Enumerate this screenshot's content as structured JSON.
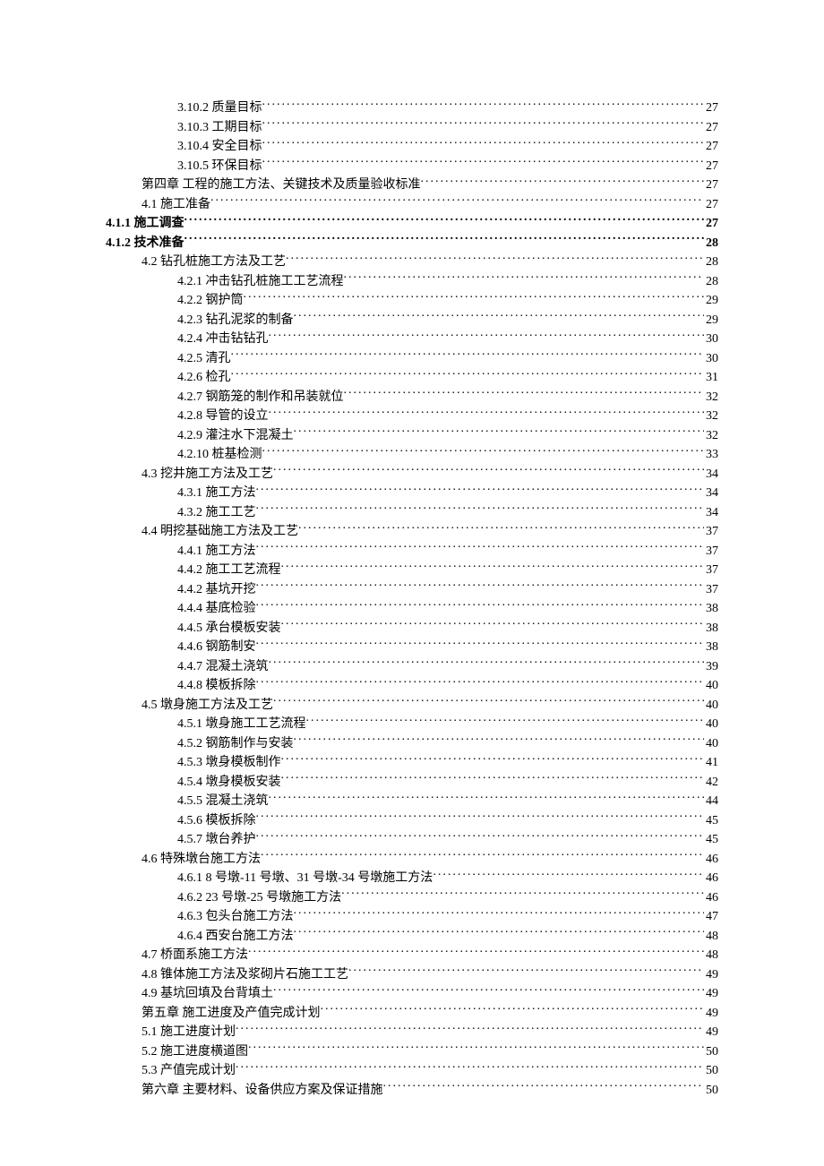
{
  "toc": [
    {
      "level": 2,
      "num": "3.10.2",
      "label": "质量目标",
      "page": "27",
      "bold": false
    },
    {
      "level": 2,
      "num": "3.10.3",
      "label": "工期目标",
      "page": "27",
      "bold": false
    },
    {
      "level": 2,
      "num": "3.10.4",
      "label": "安全目标",
      "page": "27",
      "bold": false
    },
    {
      "level": 2,
      "num": "3.10.5",
      "label": "环保目标",
      "page": "27",
      "bold": false
    },
    {
      "level": 1,
      "num": "第四章",
      "label": "  工程的施工方法、关键技术及质量验收标准",
      "page": "27",
      "bold": false
    },
    {
      "level": 1,
      "num": "4.1",
      "label": "施工准备",
      "page": "27",
      "bold": false
    },
    {
      "level": 0,
      "num": "4.1.1",
      "label": "施工调查",
      "page": "27",
      "bold": true
    },
    {
      "level": 0,
      "num": "4.1.2",
      "label": "技术准备",
      "page": "28",
      "bold": true
    },
    {
      "level": 1,
      "num": "4.2",
      "label": "钻孔桩施工方法及工艺",
      "page": "28",
      "bold": false
    },
    {
      "level": 2,
      "num": "4.2.1",
      "label": "冲击钻孔桩施工工艺流程",
      "page": "28",
      "bold": false
    },
    {
      "level": 2,
      "num": "4.2.2",
      "label": "钢护筒",
      "page": "29",
      "bold": false
    },
    {
      "level": 2,
      "num": "4.2.3",
      "label": "钻孔泥浆的制备",
      "page": "29",
      "bold": false
    },
    {
      "level": 2,
      "num": "4.2.4",
      "label": "冲击钻钻孔",
      "page": "30",
      "bold": false
    },
    {
      "level": 2,
      "num": "4.2.5",
      "label": "清孔",
      "page": "30",
      "bold": false
    },
    {
      "level": 2,
      "num": "4.2.6",
      "label": "检孔",
      "page": "31",
      "bold": false
    },
    {
      "level": 2,
      "num": "4.2.7",
      "label": "钢筋笼的制作和吊装就位",
      "page": "32",
      "bold": false
    },
    {
      "level": 2,
      "num": "4.2.8",
      "label": "导管的设立",
      "page": "32",
      "bold": false
    },
    {
      "level": 2,
      "num": "4.2.9",
      "label": "灌注水下混凝土",
      "page": "32",
      "bold": false
    },
    {
      "level": 2,
      "num": "4.2.10",
      "label": "桩基检测",
      "page": "33",
      "bold": false
    },
    {
      "level": 1,
      "num": "4.3",
      "label": "挖井施工方法及工艺",
      "page": "34",
      "bold": false
    },
    {
      "level": 2,
      "num": "4.3.1",
      "label": "施工方法",
      "page": "34",
      "bold": false
    },
    {
      "level": 2,
      "num": "4.3.2",
      "label": "施工工艺",
      "page": "34",
      "bold": false
    },
    {
      "level": 1,
      "num": "4.4",
      "label": "明挖基础施工方法及工艺",
      "page": "37",
      "bold": false
    },
    {
      "level": 2,
      "num": "4.4.1",
      "label": "施工方法",
      "page": "37",
      "bold": false
    },
    {
      "level": 2,
      "num": "4.4.2",
      "label": "施工工艺流程",
      "page": "37",
      "bold": false
    },
    {
      "level": 2,
      "num": "4.4.2",
      "label": "基坑开挖",
      "page": "37",
      "bold": false
    },
    {
      "level": 2,
      "num": "4.4.4",
      "label": "基底检验",
      "page": "38",
      "bold": false
    },
    {
      "level": 2,
      "num": "4.4.5",
      "label": "承台模板安装",
      "page": "38",
      "bold": false
    },
    {
      "level": 2,
      "num": "4.4.6",
      "label": "钢筋制安",
      "page": "38",
      "bold": false
    },
    {
      "level": 2,
      "num": "4.4.7",
      "label": "混凝土浇筑",
      "page": "39",
      "bold": false
    },
    {
      "level": 2,
      "num": "4.4.8",
      "label": "模板拆除",
      "page": "40",
      "bold": false
    },
    {
      "level": 1,
      "num": "4.5",
      "label": "墩身施工方法及工艺",
      "page": "40",
      "bold": false
    },
    {
      "level": 2,
      "num": "4.5.1",
      "label": "墩身施工工艺流程",
      "page": "40",
      "bold": false
    },
    {
      "level": 2,
      "num": "4.5.2",
      "label": "钢筋制作与安装",
      "page": "40",
      "bold": false
    },
    {
      "level": 2,
      "num": "4.5.3",
      "label": "墩身模板制作",
      "page": "41",
      "bold": false
    },
    {
      "level": 2,
      "num": "4.5.4",
      "label": "墩身模板安装",
      "page": "42",
      "bold": false
    },
    {
      "level": 2,
      "num": "4.5.5",
      "label": "混凝土浇筑",
      "page": "44",
      "bold": false
    },
    {
      "level": 2,
      "num": "4.5.6",
      "label": "模板拆除",
      "page": "45",
      "bold": false
    },
    {
      "level": 2,
      "num": "4.5.7",
      "label": "墩台养护",
      "page": "45",
      "bold": false
    },
    {
      "level": 1,
      "num": "4.6",
      "label": "特殊墩台施工方法",
      "page": "46",
      "bold": false
    },
    {
      "level": 2,
      "num": "4.6.1",
      "label": " 8 号墩-11 号墩、31 号墩-34 号墩施工方法",
      "page": "46",
      "bold": false
    },
    {
      "level": 2,
      "num": "4.6.2",
      "label": " 23 号墩-25 号墩施工方法",
      "page": "46",
      "bold": false
    },
    {
      "level": 2,
      "num": "4.6.3",
      "label": " 包头台施工方法",
      "page": "47",
      "bold": false
    },
    {
      "level": 2,
      "num": "4.6.4",
      "label": " 西安台施工方法",
      "page": "48",
      "bold": false
    },
    {
      "level": 1,
      "num": "4.7",
      "label": "桥面系施工方法",
      "page": "48",
      "bold": false
    },
    {
      "level": 1,
      "num": "4.8",
      "label": "锥体施工方法及浆砌片石施工工艺",
      "page": "49",
      "bold": false
    },
    {
      "level": 1,
      "num": "4.9",
      "label": "基坑回填及台背填土",
      "page": "49",
      "bold": false
    },
    {
      "level": 1,
      "num": "第五章",
      "label": "  施工进度及产值完成计划",
      "page": "49",
      "bold": false
    },
    {
      "level": 1,
      "num": "5.1",
      "label": "  施工进度计划",
      "page": "49",
      "bold": false
    },
    {
      "level": 1,
      "num": "5.2",
      "label": "  施工进度横道图",
      "page": "50",
      "bold": false
    },
    {
      "level": 1,
      "num": "5.3",
      "label": "  产值完成计划",
      "page": "50",
      "bold": false
    },
    {
      "level": 1,
      "num": "第六章",
      "label": "  主要材料、设备供应方案及保证措施",
      "page": "50",
      "bold": false
    }
  ]
}
